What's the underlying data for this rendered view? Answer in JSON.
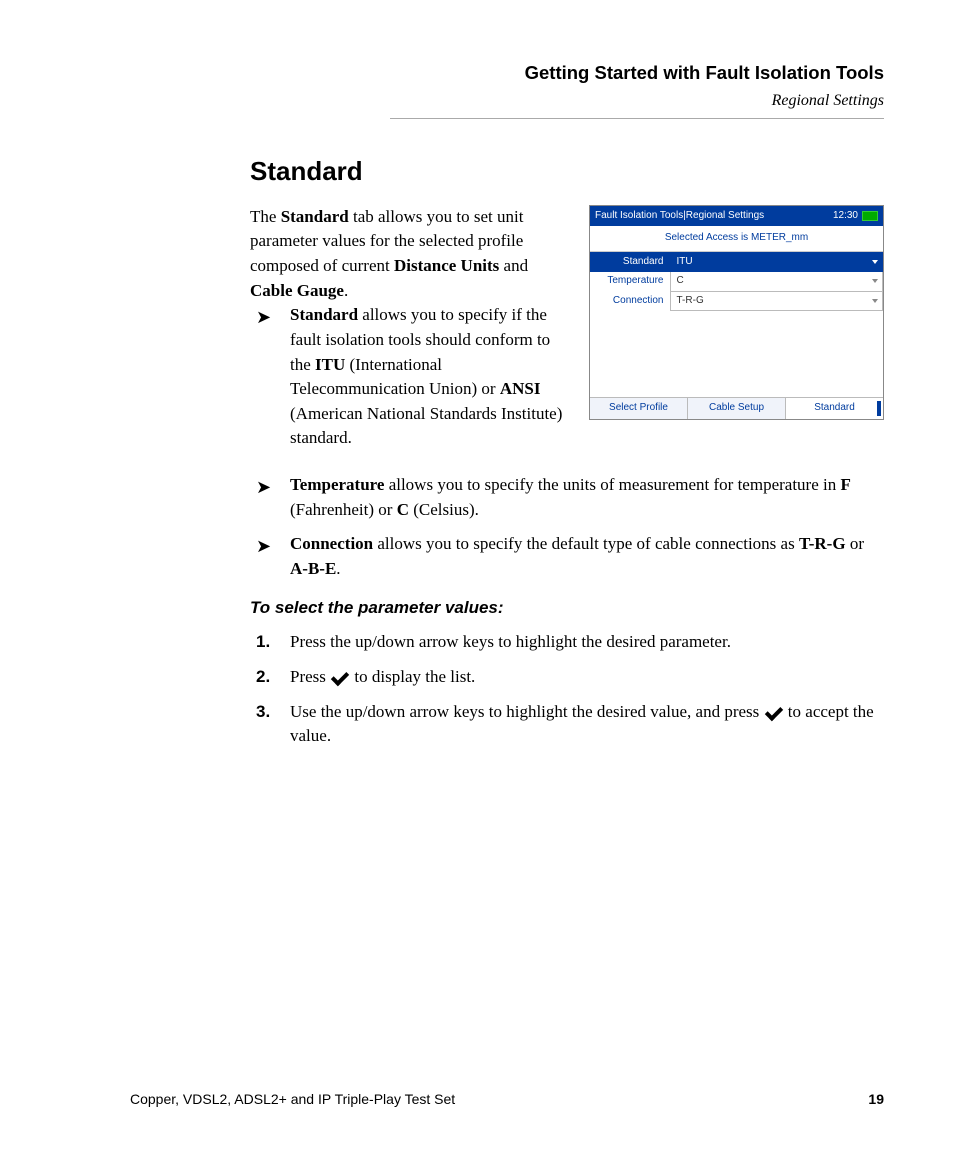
{
  "header": {
    "title": "Getting Started with Fault Isolation Tools",
    "subtitle": "Regional Settings"
  },
  "section": {
    "title": "Standard",
    "intro_pre": "The ",
    "intro_b1": "Standard",
    "intro_mid1": " tab allows you to set unit parameter values for the selected profile composed of current ",
    "intro_b2": "Distance Units",
    "intro_mid2": " and ",
    "intro_b3": "Cable Gauge",
    "intro_end": "."
  },
  "bullets": {
    "b1_lead": "Standard",
    "b1_text_a": " allows you to specify if the fault isolation tools should conform to the ",
    "b1_itu": "ITU",
    "b1_text_b": " (International Telecommunication Union) or ",
    "b1_ansi": "ANSI",
    "b1_text_c": " (American National Standards Institute) standard.",
    "b2_lead": "Temperature",
    "b2_text_a": " allows you to specify the units of measurement for temperature in ",
    "b2_f": "F",
    "b2_text_b": " (Fahrenheit) or ",
    "b2_c": "C",
    "b2_text_c": " (Celsius).",
    "b3_lead": "Connection",
    "b3_text_a": " allows you to specify the default type of cable connections as ",
    "b3_trg": "T-R-G",
    "b3_text_b": " or ",
    "b3_abe": "A-B-E",
    "b3_text_c": "."
  },
  "instructions": {
    "heading": "To select the parameter values:",
    "s1": "Press the up/down arrow keys to highlight the desired parameter.",
    "s2_a": "Press ",
    "s2_b": " to display the list.",
    "s3_a": "Use the up/down arrow keys to highlight the desired value, and press ",
    "s3_b": " to accept the value."
  },
  "screenshot": {
    "title": "Fault Isolation Tools|Regional Settings",
    "time": "12:30",
    "subheader": "Selected Access  is METER_mm",
    "rows": [
      {
        "label": "Standard",
        "value": "ITU",
        "selected": true
      },
      {
        "label": "Temperature",
        "value": "C",
        "selected": false
      },
      {
        "label": "Connection",
        "value": "T-R-G",
        "selected": false
      }
    ],
    "tabs": [
      "Select Profile",
      "Cable Setup",
      "Standard"
    ]
  },
  "footer": {
    "left": "Copper, VDSL2, ADSL2+ and IP Triple-Play Test Set",
    "page": "19"
  }
}
